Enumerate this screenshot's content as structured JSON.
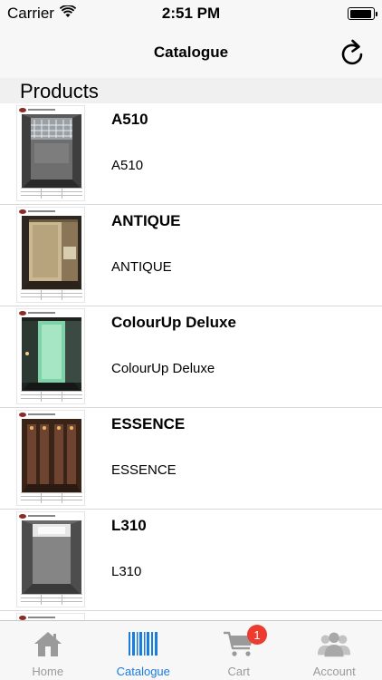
{
  "status_bar": {
    "carrier": "Carrier",
    "time": "2:51 PM",
    "battery_level": 0.95
  },
  "nav": {
    "title": "Catalogue",
    "refresh_icon": "refresh-icon"
  },
  "section": {
    "title": "Products"
  },
  "products": [
    {
      "name": "A510",
      "description": "A510"
    },
    {
      "name": "ANTIQUE",
      "description": "ANTIQUE"
    },
    {
      "name": "ColourUp Deluxe",
      "description": "ColourUp Deluxe"
    },
    {
      "name": "ESSENCE",
      "description": "ESSENCE"
    },
    {
      "name": "L310",
      "description": "L310"
    }
  ],
  "tab_bar": {
    "tabs": [
      {
        "label": "Home",
        "icon": "home-icon"
      },
      {
        "label": "Catalogue",
        "icon": "barcode-icon"
      },
      {
        "label": "Cart",
        "icon": "cart-icon",
        "badge": "1"
      },
      {
        "label": "Account",
        "icon": "account-icon"
      }
    ],
    "active_tab": "Catalogue"
  },
  "colors": {
    "accent": "#1a7ce0",
    "badge": "#ee3b30",
    "inactive": "#9a9a9a"
  }
}
